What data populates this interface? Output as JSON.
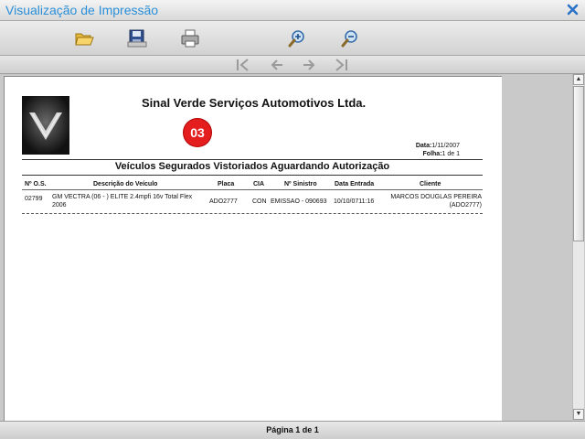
{
  "window": {
    "title": "Visualização de Impressão"
  },
  "toolbar": {
    "buttons": [
      {
        "name": "open",
        "icon": "folder-icon"
      },
      {
        "name": "save",
        "icon": "save-disk-icon"
      },
      {
        "name": "print",
        "icon": "printer-icon"
      },
      {
        "name": "zoom_in",
        "icon": "zoom-in-icon"
      },
      {
        "name": "zoom_out",
        "icon": "zoom-out-icon"
      }
    ]
  },
  "report": {
    "company": "Sinal Verde Serviços Automotivos Ltda.",
    "badge": "03",
    "date_label": "Data:",
    "date_value": "1/11/2007",
    "sheet_label": "Folha:",
    "sheet_value": "1 de 1",
    "title": "Veículos Segurados Vistoriados Aguardando Autorização",
    "columns": [
      "Nº O.S.",
      "Descrição do Veículo",
      "Placa",
      "CIA",
      "Nº Sinistro",
      "Data Entrada",
      "Cliente"
    ],
    "rows": [
      {
        "os": "02799",
        "descricao_1": "GM VECTRA (06 - ) ELITE 2.4mpfi 16v Total Flex",
        "descricao_2": "2006",
        "placa": "ADO2777",
        "cia": "CON",
        "sinistro": "EMISSAO - 090693",
        "entrada": "10/10/0711:16",
        "cliente_1": "MARCOS DOUGLAS PEREIRA",
        "cliente_2": "(ADO2777)"
      }
    ]
  },
  "status": {
    "page_text": "Página 1 de 1"
  },
  "colors": {
    "title": "#2a8fd8",
    "badge": "#e41e1e"
  }
}
